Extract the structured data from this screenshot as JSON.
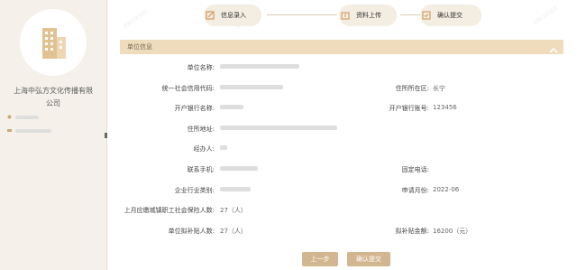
{
  "company": {
    "name_line1": "上海中弘方文化传播有限",
    "name_line2": "公司"
  },
  "steps": [
    {
      "label": "信息录入"
    },
    {
      "label": "资料上传"
    },
    {
      "label": "确认提交"
    }
  ],
  "section": {
    "title": "单位信息"
  },
  "form": {
    "unit_name_label": "单位名称:",
    "credit_code_label": "统一社会信用代码:",
    "district_label": "住所所在区:",
    "district_value": "长宁",
    "bank_name_label": "开户银行名称:",
    "bank_account_label": "开户银行账号:",
    "bank_account_value": "123456",
    "address_label": "住所地址:",
    "handler_label": "经办人:",
    "phone_label": "联系手机:",
    "landline_label": "固定电话:",
    "industry_label": "企业行业类别:",
    "apply_month_label": "申请月份:",
    "apply_month_value": "2022-06",
    "insured_label": "上月应缴城镇职工社会保险人数:",
    "insured_value": "27（人）",
    "subsidy_people_label": "单位拟补贴人数:",
    "subsidy_people_value": "27（人）",
    "subsidy_amount_label": "拟补贴金额:",
    "subsidy_amount_value": "16200（元）"
  },
  "buttons": {
    "prev": "上一步",
    "submit": "确认提交"
  },
  "colors": {
    "accent": "#d2b68f",
    "section_bg": "#eedcbd",
    "left_bg": "#f5f1ea"
  }
}
